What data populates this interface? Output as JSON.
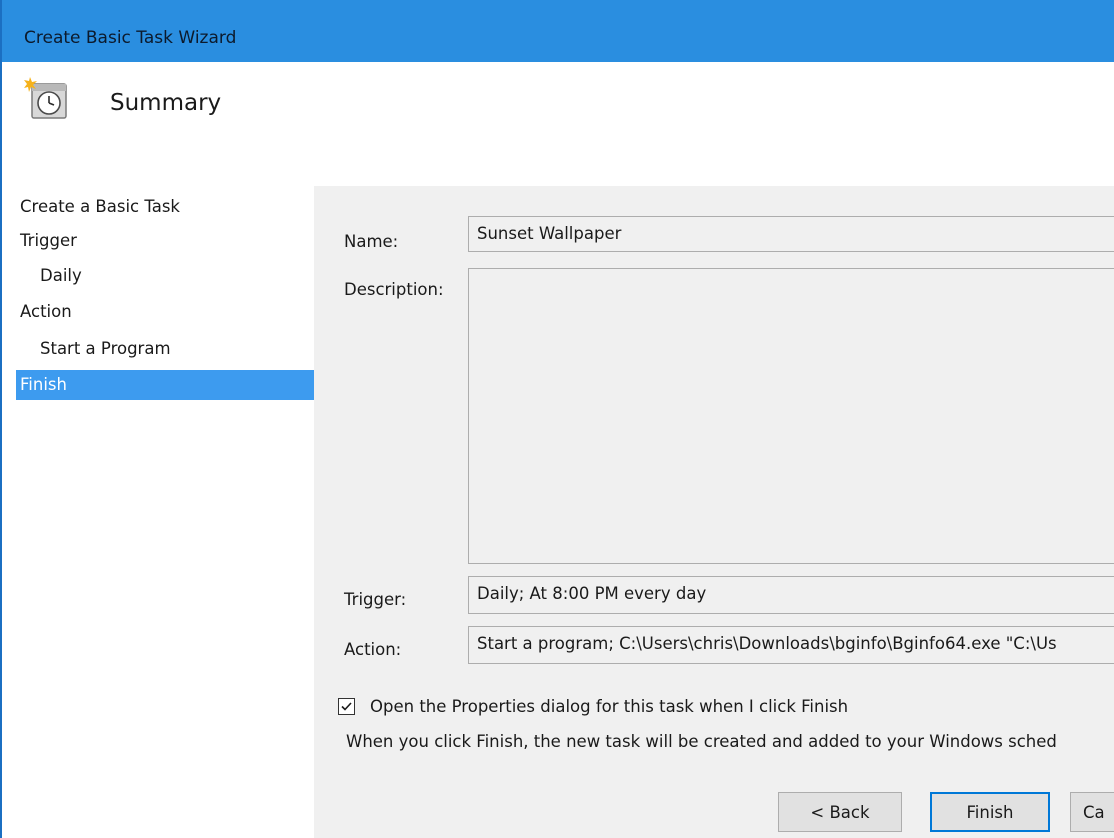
{
  "window": {
    "title": "Create Basic Task Wizard"
  },
  "header": {
    "title": "Summary",
    "icon": "scheduled-task-clock-icon"
  },
  "steps": [
    {
      "label": "Create a Basic Task",
      "sub": false,
      "active": false
    },
    {
      "label": "Trigger",
      "sub": false,
      "active": false
    },
    {
      "label": "Daily",
      "sub": true,
      "active": false
    },
    {
      "label": "Action",
      "sub": false,
      "active": false
    },
    {
      "label": "Start a Program",
      "sub": true,
      "active": false
    },
    {
      "label": "Finish",
      "sub": false,
      "active": true
    }
  ],
  "form": {
    "name_label": "Name:",
    "name_value": "Sunset Wallpaper",
    "description_label": "Description:",
    "description_value": "",
    "trigger_label": "Trigger:",
    "trigger_value": "Daily; At 8:00 PM every day",
    "action_label": "Action:",
    "action_value": "Start a program; C:\\Users\\chris\\Downloads\\bginfo\\Bginfo64.exe \"C:\\Us"
  },
  "open_properties": {
    "label": "Open the Properties dialog for this task when I click Finish",
    "checked": true
  },
  "info_text": "When you click Finish, the new task will be created and added to your Windows sched",
  "buttons": {
    "back": "< Back",
    "finish": "Finish",
    "cancel": "Ca"
  },
  "colors": {
    "titlebar": "#2a8ee0",
    "selected_step": "#3d9bef",
    "content_bg": "#f0f0f0"
  }
}
